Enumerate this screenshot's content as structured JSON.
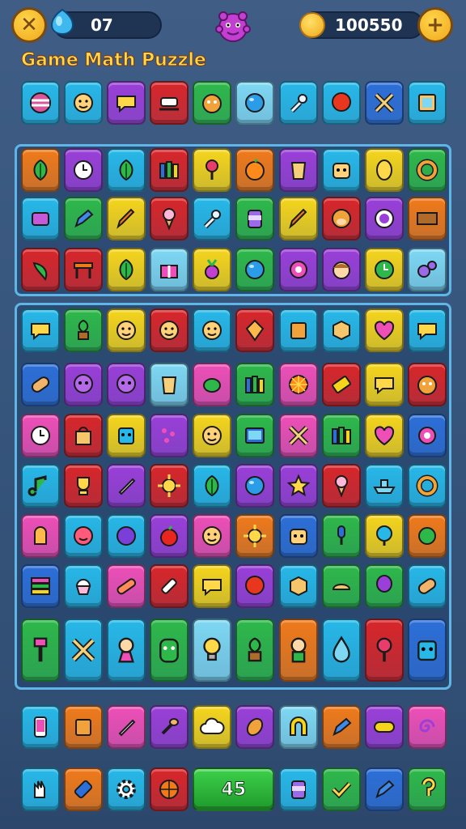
{
  "header": {
    "gems_count": "07",
    "coins_count": "100550",
    "close_icon": "close-icon",
    "add_icon": "plus-icon",
    "title": "Game Math Puzzle"
  },
  "colors": {
    "orange": "#f07a1a",
    "purple": "#9a3fd8",
    "cyan": "#27b8e8",
    "red": "#d8262a",
    "green": "#2eb84a",
    "yellow": "#f5d51c",
    "blue": "#2d6fd8",
    "pink": "#ee4fb7",
    "lightblue": "#7fd8f3",
    "gold": "#f0a81c"
  },
  "rows": {
    "row0": [
      {
        "bg": "cyan",
        "icon": "ball-icon"
      },
      {
        "bg": "cyan",
        "icon": "face-icon"
      },
      {
        "bg": "purple",
        "icon": "speech-bubble-icon"
      },
      {
        "bg": "red",
        "icon": "sled-icon"
      },
      {
        "bg": "green",
        "icon": "monster-icon"
      },
      {
        "bg": "lightblue",
        "icon": "blue-orb-icon"
      },
      {
        "bg": "cyan",
        "icon": "wrench-icon"
      },
      {
        "bg": "cyan",
        "icon": "red-bubble-icon"
      },
      {
        "bg": "blue",
        "icon": "crossed-tools-icon"
      },
      {
        "bg": "cyan",
        "icon": "frame-icon"
      }
    ],
    "row1": [
      {
        "bg": "orange",
        "icon": "leaf-icon"
      },
      {
        "bg": "purple",
        "icon": "clock-icon"
      },
      {
        "bg": "cyan",
        "icon": "leaf-icon"
      },
      {
        "bg": "red",
        "icon": "books-icon"
      },
      {
        "bg": "yellow",
        "icon": "lollipop-icon"
      },
      {
        "bg": "orange",
        "icon": "orange-fruit-icon"
      },
      {
        "bg": "purple",
        "icon": "cup-icon"
      },
      {
        "bg": "cyan",
        "icon": "robot-face-icon"
      },
      {
        "bg": "yellow",
        "icon": "lemon-icon"
      },
      {
        "bg": "green",
        "icon": "ring-icon"
      }
    ],
    "row2": [
      {
        "bg": "cyan",
        "icon": "gem-box-icon"
      },
      {
        "bg": "green",
        "icon": "pencil-icon"
      },
      {
        "bg": "yellow",
        "icon": "crayon-icon"
      },
      {
        "bg": "red",
        "icon": "ice-cream-icon"
      },
      {
        "bg": "cyan",
        "icon": "wrench-icon"
      },
      {
        "bg": "green",
        "icon": "jar-icon"
      },
      {
        "bg": "yellow",
        "icon": "crayon-icon"
      },
      {
        "bg": "red",
        "icon": "monkey-icon"
      },
      {
        "bg": "purple",
        "icon": "target-icon"
      },
      {
        "bg": "orange",
        "icon": "sign-icon"
      }
    ],
    "row3": [
      {
        "bg": "red",
        "icon": "chili-icon"
      },
      {
        "bg": "red",
        "icon": "table-icon"
      },
      {
        "bg": "yellow",
        "icon": "leaf-icon"
      },
      {
        "bg": "lightblue",
        "icon": "gift-icon"
      },
      {
        "bg": "yellow",
        "icon": "radish-icon"
      },
      {
        "bg": "green",
        "icon": "blue-orb-icon"
      },
      {
        "bg": "purple",
        "icon": "gear-eye-icon"
      },
      {
        "bg": "purple",
        "icon": "kid-face-icon"
      },
      {
        "bg": "yellow",
        "icon": "clock-green-icon"
      },
      {
        "bg": "lightblue",
        "icon": "gears-icon"
      }
    ],
    "row4": [
      {
        "bg": "cyan",
        "icon": "speech-bubble-icon"
      },
      {
        "bg": "green",
        "icon": "plant-icon"
      },
      {
        "bg": "yellow",
        "icon": "face-icon"
      },
      {
        "bg": "red",
        "icon": "face-icon"
      },
      {
        "bg": "cyan",
        "icon": "face-icon"
      },
      {
        "bg": "red",
        "icon": "diamond-icon"
      },
      {
        "bg": "cyan",
        "icon": "box-icon"
      },
      {
        "bg": "cyan",
        "icon": "cube-icon"
      },
      {
        "bg": "yellow",
        "icon": "heart-icon"
      },
      {
        "bg": "cyan",
        "icon": "speech-bubble-icon"
      }
    ],
    "row5": [
      {
        "bg": "blue",
        "icon": "bread-icon"
      },
      {
        "bg": "purple",
        "icon": "alien-icon"
      },
      {
        "bg": "purple",
        "icon": "alien-icon"
      },
      {
        "bg": "lightblue",
        "icon": "cup-icon"
      },
      {
        "bg": "pink",
        "icon": "turtle-icon"
      },
      {
        "bg": "green",
        "icon": "books-icon"
      },
      {
        "bg": "pink",
        "icon": "orange-slice-icon"
      },
      {
        "bg": "red",
        "icon": "battery-icon"
      },
      {
        "bg": "yellow",
        "icon": "speech-bubble-icon"
      },
      {
        "bg": "red",
        "icon": "monster-icon"
      }
    ],
    "row6": [
      {
        "bg": "pink",
        "icon": "clock-icon"
      },
      {
        "bg": "red",
        "icon": "shopping-bag-icon"
      },
      {
        "bg": "yellow",
        "icon": "robot-icon"
      },
      {
        "bg": "purple",
        "icon": "scatter-icon"
      },
      {
        "bg": "yellow",
        "icon": "face-icon"
      },
      {
        "bg": "green",
        "icon": "screen-icon"
      },
      {
        "bg": "pink",
        "icon": "crossed-tools-icon"
      },
      {
        "bg": "green",
        "icon": "books-icon"
      },
      {
        "bg": "yellow",
        "icon": "heart-icon"
      },
      {
        "bg": "blue",
        "icon": "gear-eye-icon"
      }
    ],
    "row7": [
      {
        "bg": "cyan",
        "icon": "note-icon"
      },
      {
        "bg": "red",
        "icon": "trophy-icon"
      },
      {
        "bg": "purple",
        "icon": "rocket-icon"
      },
      {
        "bg": "red",
        "icon": "sun-icon"
      },
      {
        "bg": "cyan",
        "icon": "leaf-icon"
      },
      {
        "bg": "purple",
        "icon": "blue-orb-icon"
      },
      {
        "bg": "purple",
        "icon": "star-icon"
      },
      {
        "bg": "red",
        "icon": "ice-cream-icon"
      },
      {
        "bg": "cyan",
        "icon": "boat-icon"
      },
      {
        "bg": "cyan",
        "icon": "ring-icon"
      }
    ],
    "row8": [
      {
        "bg": "pink",
        "icon": "mitten-icon"
      },
      {
        "bg": "cyan",
        "icon": "smiley-icon"
      },
      {
        "bg": "cyan",
        "icon": "purple-orb-icon"
      },
      {
        "bg": "purple",
        "icon": "apple-icon"
      },
      {
        "bg": "pink",
        "icon": "face-icon"
      },
      {
        "bg": "orange",
        "icon": "sun-icon"
      },
      {
        "bg": "blue",
        "icon": "robot-face-icon"
      },
      {
        "bg": "green",
        "icon": "mic-icon"
      },
      {
        "bg": "yellow",
        "icon": "tree-icon"
      },
      {
        "bg": "orange",
        "icon": "planet-icon"
      }
    ],
    "row9": [
      {
        "bg": "blue",
        "icon": "stack-icon"
      },
      {
        "bg": "cyan",
        "icon": "cupcake-icon"
      },
      {
        "bg": "pink",
        "icon": "bandage-icon"
      },
      {
        "bg": "red",
        "icon": "paint-tube-icon"
      },
      {
        "bg": "yellow",
        "icon": "speech-bubble-icon"
      },
      {
        "bg": "purple",
        "icon": "red-bubble-icon"
      },
      {
        "bg": "cyan",
        "icon": "cube-icon"
      },
      {
        "bg": "green",
        "icon": "hat-icon"
      },
      {
        "bg": "green",
        "icon": "balloon-icon"
      },
      {
        "bg": "cyan",
        "icon": "bread-icon"
      }
    ],
    "row10": [
      {
        "bg": "green",
        "icon": "paintbrush-icon"
      },
      {
        "bg": "cyan",
        "icon": "crossed-tools-icon"
      },
      {
        "bg": "cyan",
        "icon": "girl-icon"
      },
      {
        "bg": "green",
        "icon": "green-monster-icon"
      },
      {
        "bg": "lightblue",
        "icon": "lamp-icon"
      },
      {
        "bg": "green",
        "icon": "plant-icon"
      },
      {
        "bg": "orange",
        "icon": "boy-icon"
      },
      {
        "bg": "cyan",
        "icon": "potion-icon"
      },
      {
        "bg": "red",
        "icon": "lollipop-icon"
      },
      {
        "bg": "blue",
        "icon": "robot-icon"
      }
    ],
    "row11": [
      {
        "bg": "cyan",
        "icon": "phone-icon"
      },
      {
        "bg": "orange",
        "icon": "box-icon"
      },
      {
        "bg": "pink",
        "icon": "rocket-icon"
      },
      {
        "bg": "purple",
        "icon": "shovel-icon"
      },
      {
        "bg": "yellow",
        "icon": "cloud-icon"
      },
      {
        "bg": "purple",
        "icon": "seed-icon"
      },
      {
        "bg": "lightblue",
        "icon": "arch-icon"
      },
      {
        "bg": "orange",
        "icon": "pencil-icon"
      },
      {
        "bg": "purple",
        "icon": "pill-icon"
      },
      {
        "bg": "pink",
        "icon": "spiral-icon"
      }
    ],
    "row12_left": [
      {
        "bg": "cyan",
        "icon": "glove-icon"
      },
      {
        "bg": "orange",
        "icon": "paint-icon"
      },
      {
        "bg": "cyan",
        "icon": "gear-icon"
      },
      {
        "bg": "red",
        "icon": "basketball-icon"
      }
    ],
    "row12_number": "45",
    "row12_right": [
      {
        "bg": "cyan",
        "icon": "jar-icon"
      },
      {
        "bg": "green",
        "icon": "check-icon"
      },
      {
        "bg": "blue",
        "icon": "pencil-icon"
      },
      {
        "bg": "green",
        "icon": "hook-icon"
      }
    ]
  }
}
